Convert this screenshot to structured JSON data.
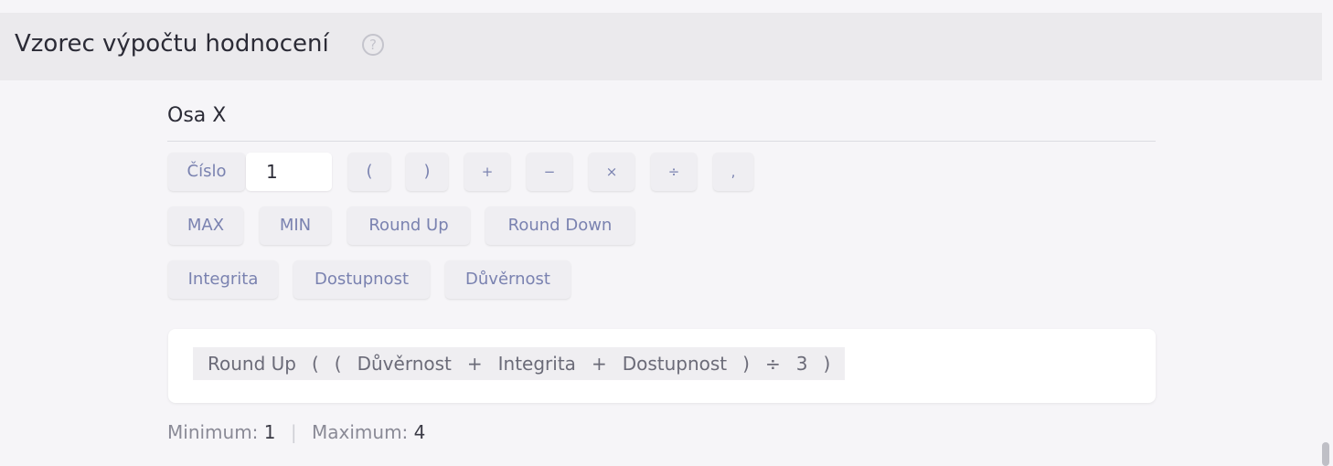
{
  "section": {
    "title": "Vzorec výpočtu hodnocení",
    "help_icon": "?"
  },
  "axis": {
    "title": "Osa X"
  },
  "toolbar": {
    "number_label": "Číslo",
    "number_value": "1",
    "operators": [
      "(",
      ")",
      "+",
      "−",
      "×",
      "÷",
      ","
    ],
    "functions": [
      "MAX",
      "MIN",
      "Round Up",
      "Round Down"
    ],
    "variables": [
      "Integrita",
      "Dostupnost",
      "Důvěrnost"
    ]
  },
  "formula": {
    "tokens": [
      "Round Up",
      "(",
      "(",
      "Důvěrnost",
      "+",
      "Integrita",
      "+",
      "Dostupnost",
      ")",
      "÷",
      "3",
      ")"
    ]
  },
  "range": {
    "min_label": "Minimum:",
    "min_value": "1",
    "separator": "|",
    "max_label": "Maximum:",
    "max_value": "4"
  }
}
